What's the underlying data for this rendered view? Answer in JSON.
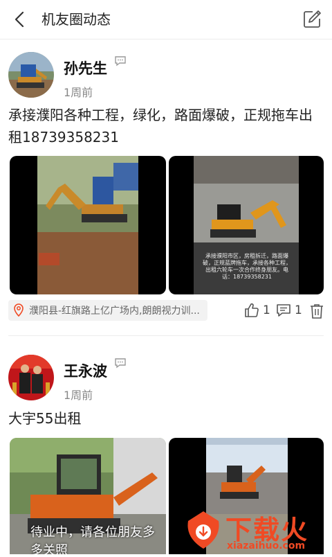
{
  "header": {
    "title": "机友圈动态"
  },
  "posts": [
    {
      "author": "孙先生",
      "time": "1周前",
      "text": "承接濮阳各种工程，绿化，路面爆破，正规拖车出租18739358231",
      "location": "濮阳县-红旗路上亿广场内,朗朗视力训...",
      "likes": "1",
      "comments": "1",
      "image2_caption": "承接濮阳市区，房租拆迁，路面爆破，正规蓝牌拖车，承接各种工程，出租六轮车一次合作终身朋友。电话：18739358231"
    },
    {
      "author": "王永波",
      "time": "1周前",
      "text": "大宇55出租",
      "image1_caption": "待业中，请各位朋友多多关照"
    }
  ],
  "watermark": {
    "text": "下载火",
    "url": "xiazaihuo.com"
  },
  "colors": {
    "accent": "#f04a24",
    "excavator": "#d9621c"
  }
}
